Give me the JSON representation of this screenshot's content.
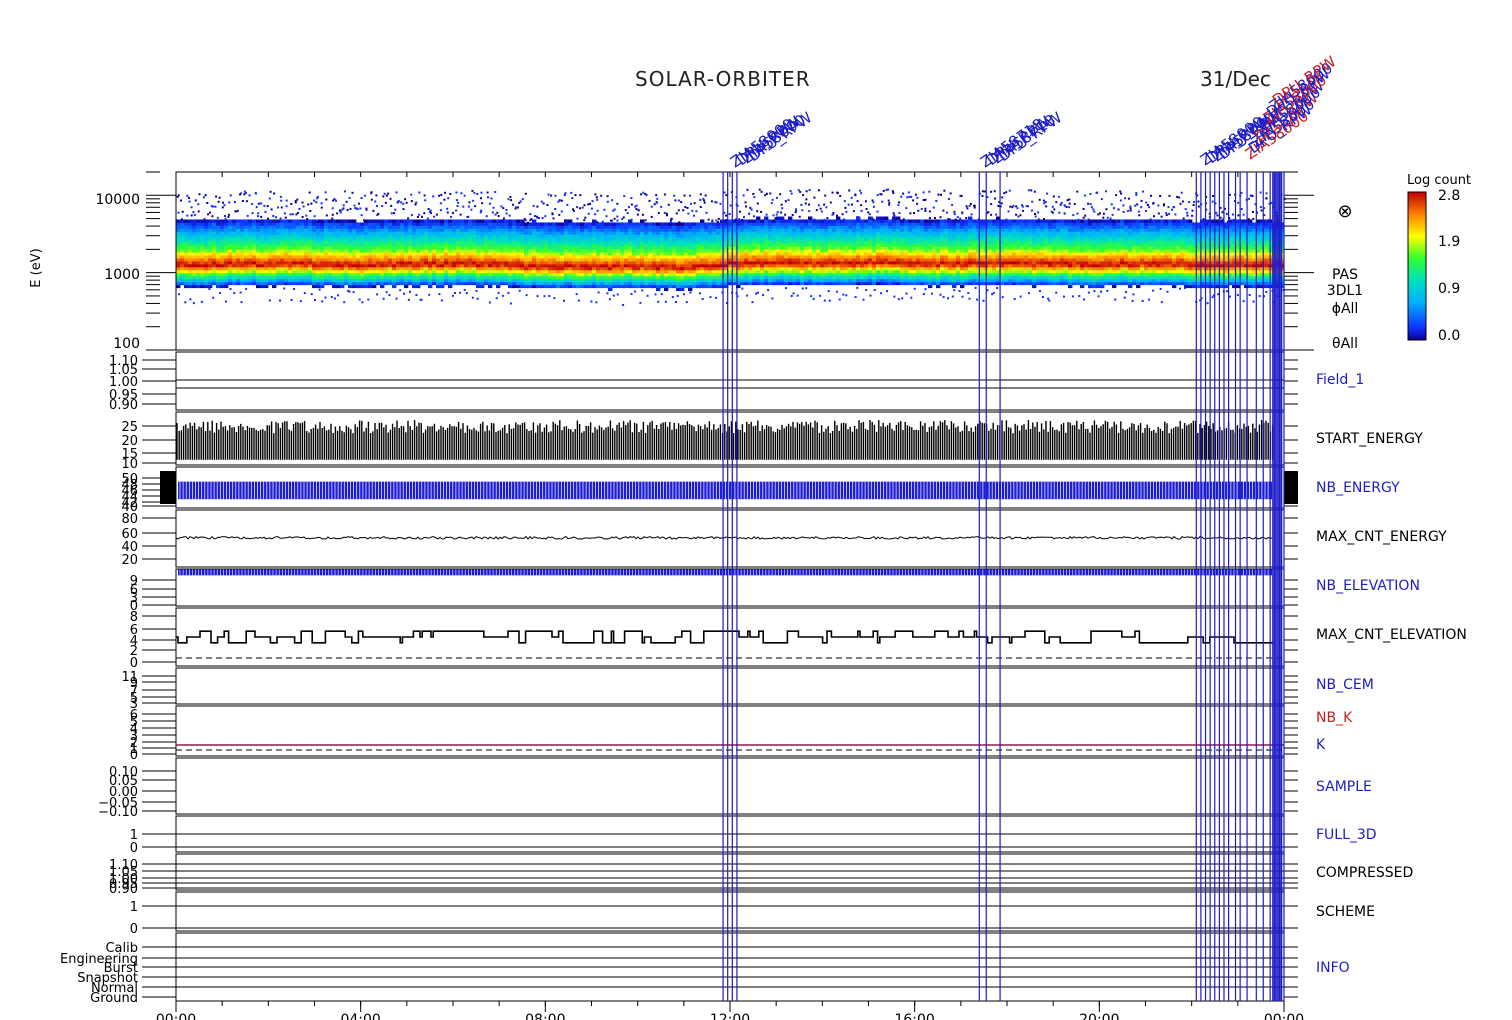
{
  "header": {
    "title": "SOLAR-ORBITER",
    "date": "31/Dec"
  },
  "colorbar": {
    "title": "Log count",
    "ticks": [
      "2.8",
      "1.9",
      "0.9",
      "0.0"
    ]
  },
  "spectrogram": {
    "ylabel": "E (eV)",
    "yticks": [
      "10000",
      "1000",
      "100"
    ],
    "side_labels": [
      "PAS",
      "3DL1",
      "ϕAll",
      "θAll"
    ],
    "symbol": "⊗"
  },
  "panels": [
    {
      "label": "Field_1",
      "color": "#1d1dc8",
      "ticks": [
        "1.10",
        "1.05",
        "1.00",
        "0.95",
        "0.90"
      ]
    },
    {
      "label": "START_ENERGY",
      "color": "#000000",
      "ticks": [
        "25",
        "20",
        "15",
        "10"
      ]
    },
    {
      "label": "NB_ENERGY",
      "color": "#1d1dc8",
      "ticks": [
        "50",
        "48",
        "46",
        "44",
        "42",
        "40"
      ]
    },
    {
      "label": "MAX_CNT_ENERGY",
      "color": "#000000",
      "ticks": [
        "80",
        "60",
        "40",
        "20"
      ]
    },
    {
      "label": "NB_ELEVATION",
      "color": "#1d1dc8",
      "ticks": [
        "9",
        "6",
        "3",
        "0"
      ]
    },
    {
      "label": "MAX_CNT_ELEVATION",
      "color": "#000000",
      "ticks": [
        "8",
        "6",
        "4",
        "2",
        "0"
      ]
    },
    {
      "label": "NB_CEM",
      "color": "#1d1dc8",
      "ticks": [
        "11",
        "9",
        "7",
        "5",
        "3"
      ]
    },
    {
      "label": "NB_K",
      "color": "#cc1f1f",
      "ticks": [
        "6",
        "5",
        "4",
        "3",
        "2",
        "1",
        "0"
      ]
    },
    {
      "label": "K",
      "color": "#1d1dc8",
      "ticks": []
    },
    {
      "label": "SAMPLE",
      "color": "#1d1dc8",
      "ticks": [
        "0.10",
        "0.05",
        "0.00",
        "−0.05",
        "−0.10"
      ]
    },
    {
      "label": "FULL_3D",
      "color": "#1d1dc8",
      "ticks": [
        "1",
        "0"
      ]
    },
    {
      "label": "COMPRESSED",
      "color": "#000000",
      "ticks": [
        "1.10",
        "1.05",
        "1.00",
        "0.95",
        "0.90"
      ]
    },
    {
      "label": "SCHEME",
      "color": "#000000",
      "ticks": [
        "1",
        "0"
      ]
    },
    {
      "label": "INFO",
      "color": "#1d1dc8",
      "ticks": [
        "Calib",
        "Engineering",
        "Burst",
        "Snapshot",
        "Normal",
        "Ground"
      ]
    }
  ],
  "event_labels": [
    "ZIA58000",
    "DPU_RPW",
    "ZIA58718",
    "DPU_RPW",
    "ZIA58000",
    "DPU_RPW"
  ],
  "chart_data": {
    "type": "heatmap",
    "x_tick_labels": [
      "00:00",
      "04:00",
      "08:00",
      "12:00",
      "16:00",
      "20:00",
      "00:00"
    ],
    "x_range_hours": [
      0,
      24
    ],
    "spectrogram": {
      "ylabel": "E (eV)",
      "yscale": "log",
      "ylim": [
        100,
        20000
      ],
      "colorbar_label": "Log count",
      "colorbar_range": [
        0.0,
        2.8
      ],
      "peak_energy_eV": [
        [
          0,
          1250
        ],
        [
          2,
          1300
        ],
        [
          4,
          1250
        ],
        [
          6,
          1300
        ],
        [
          8,
          1200
        ],
        [
          10,
          1200
        ],
        [
          11,
          1150
        ],
        [
          12,
          1300
        ],
        [
          13,
          1350
        ],
        [
          14,
          1300
        ],
        [
          15,
          1350
        ],
        [
          16,
          1300
        ],
        [
          17,
          1300
        ],
        [
          18,
          1300
        ],
        [
          19,
          1300
        ],
        [
          20,
          1250
        ],
        [
          21,
          1300
        ],
        [
          22,
          1250
        ],
        [
          24,
          1250
        ]
      ],
      "core_width_decades": 0.17,
      "outer_width_decades": 0.4
    },
    "max_cnt_energy": {
      "ylim": [
        0,
        90
      ],
      "approx_value": 46
    },
    "start_energy": {
      "ylim": [
        8,
        28
      ],
      "typical_low": 10,
      "typical_high": 25
    },
    "nb_energy": {
      "ylim": [
        38,
        52
      ],
      "band_low": 41,
      "band_high": 47
    },
    "nb_elevation": {
      "ylim": [
        -1,
        10
      ],
      "value": 9
    },
    "max_cnt_elevation": {
      "ylim": [
        -1,
        9
      ],
      "levels": [
        3,
        4,
        5
      ]
    },
    "event_times_hours": [
      11.85,
      11.95,
      12.05,
      12.15,
      17.4,
      17.55,
      17.85,
      22.1,
      22.2,
      22.3,
      22.4,
      22.5,
      22.6,
      22.7,
      22.8,
      22.95,
      23.05,
      23.2,
      23.4,
      23.55,
      23.7,
      23.8,
      23.9,
      23.95,
      24.0
    ]
  }
}
